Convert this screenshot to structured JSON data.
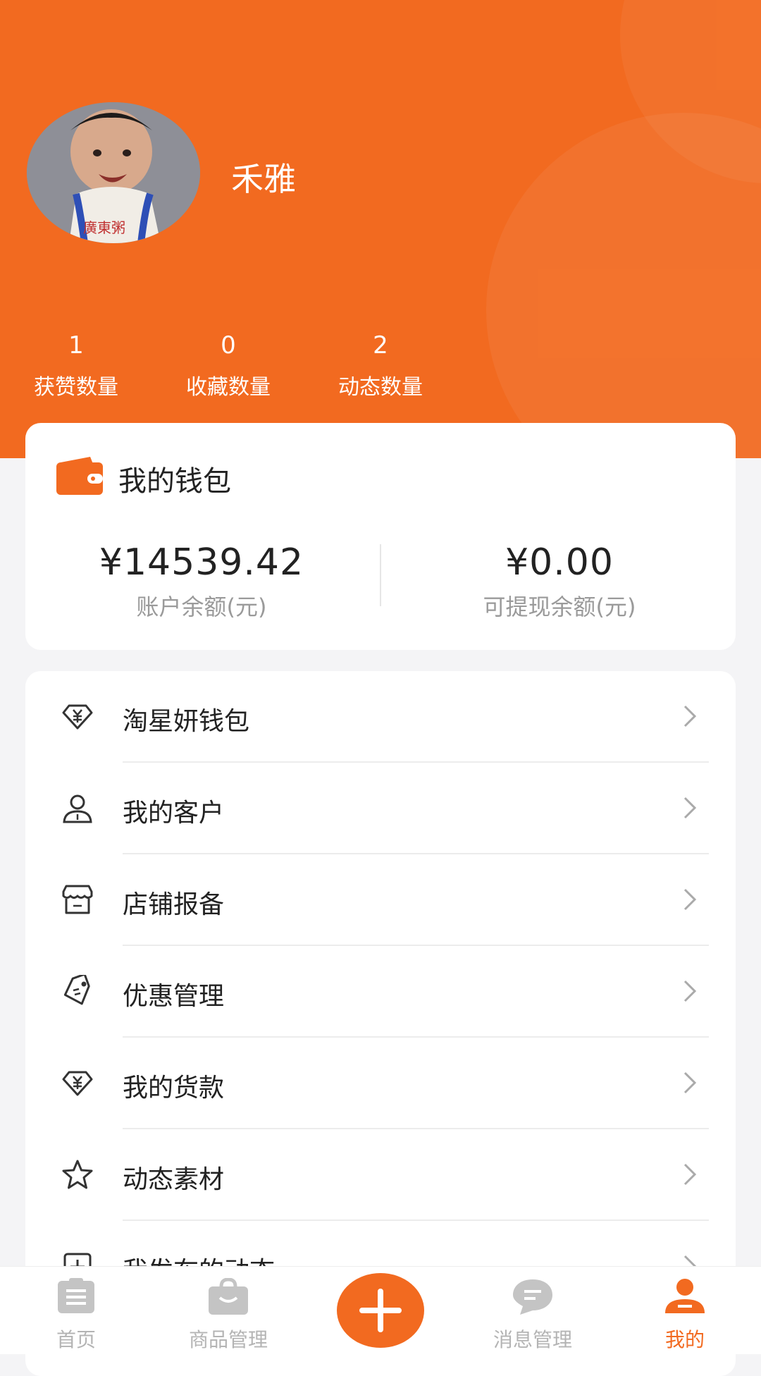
{
  "profile": {
    "name": "禾雅"
  },
  "stats": [
    {
      "value": "1",
      "label": "获赞数量"
    },
    {
      "value": "0",
      "label": "收藏数量"
    },
    {
      "value": "2",
      "label": "动态数量"
    }
  ],
  "wallet": {
    "title": "我的钱包",
    "balance": {
      "amount": "¥14539.42",
      "label": "账户余额(元)"
    },
    "withdrawable": {
      "amount": "¥0.00",
      "label": "可提现余额(元)"
    }
  },
  "menu": [
    {
      "label": "淘星妍钱包",
      "icon": "diamond-yen-icon"
    },
    {
      "label": "我的客户",
      "icon": "user-icon"
    },
    {
      "label": "店铺报备",
      "icon": "store-icon"
    },
    {
      "label": "优惠管理",
      "icon": "coupon-icon"
    },
    {
      "label": "我的货款",
      "icon": "diamond-yen-icon"
    },
    {
      "label": "动态素材",
      "icon": "star-icon"
    },
    {
      "label": "我发布的动态",
      "icon": "plus-square-icon"
    }
  ],
  "tabs": [
    {
      "label": "首页",
      "icon": "home-doc-icon"
    },
    {
      "label": "商品管理",
      "icon": "bag-icon"
    },
    {
      "label": "消息管理",
      "icon": "chat-icon"
    },
    {
      "label": "我的",
      "icon": "profile-icon"
    }
  ],
  "colors": {
    "accent": "#f26a20",
    "inactive": "#b4b4b4"
  }
}
